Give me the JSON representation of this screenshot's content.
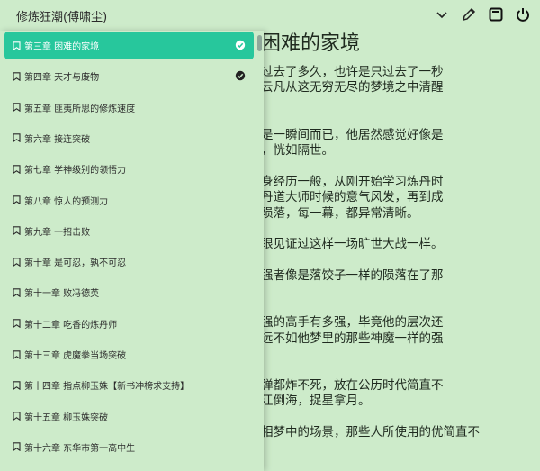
{
  "window": {
    "title": "修炼狂潮(傅啸尘)",
    "controls": [
      "chevron-down-icon",
      "pen-icon",
      "fullscreen-icon",
      "power-icon"
    ]
  },
  "sidebar": {
    "chapters": [
      {
        "label": "第三章 困难的家境",
        "active": true,
        "read": true
      },
      {
        "label": "第四章 天才与废物",
        "active": false,
        "read": true
      },
      {
        "label": "第五章 匪夷所思的修炼速度",
        "active": false,
        "read": false
      },
      {
        "label": "第六章 接连突破",
        "active": false,
        "read": false
      },
      {
        "label": "第七章 学神级别的领悟力",
        "active": false,
        "read": false
      },
      {
        "label": "第八章 惊人的预测力",
        "active": false,
        "read": false
      },
      {
        "label": "第九章 一招击败",
        "active": false,
        "read": false
      },
      {
        "label": "第十章 是可忍，孰不可忍",
        "active": false,
        "read": false
      },
      {
        "label": "第十一章 败冯德英",
        "active": false,
        "read": false
      },
      {
        "label": "第十二章 吃香的炼丹师",
        "active": false,
        "read": false
      },
      {
        "label": "第十三章 虎魔拳当场突破",
        "active": false,
        "read": false
      },
      {
        "label": "第十四章 指点柳玉姝【新书冲榜求支持】",
        "active": false,
        "read": false
      },
      {
        "label": "第十五章 柳玉姝突破",
        "active": false,
        "read": false
      },
      {
        "label": "第十六章 东华市第一高中生",
        "active": false,
        "read": false
      }
    ]
  },
  "content": {
    "heading": "困难的家境",
    "lines": [
      "过去了多久，也许是只过去了一秒",
      "云凡从这无穷无尽的梦境之中清醒",
      "",
      "",
      "是一瞬间而已，他居然感觉好像是",
      "，恍如隔世。",
      "",
      "身经历一般，从刚开始学习炼丹时",
      "丹道大师时候的意气风发，再到成",
      "陨落，每一幕，都异常清晰。",
      "",
      "眼见证过这样一场旷世大战一样。",
      "",
      "强者像是落饺子一样的陨落在了那",
      "",
      "",
      "强的高手有多强，毕竟他的层次还",
      "远不如他梦里的那些神魔一样的强",
      "",
      "",
      "弹都炸不死，放在公历时代简直不",
      "江倒海，捉星拿月。",
      "",
      "相梦中的场景，那些人所使用的优简直不"
    ]
  },
  "colors": {
    "background": "#cdebca",
    "accent": "#27c79c"
  }
}
